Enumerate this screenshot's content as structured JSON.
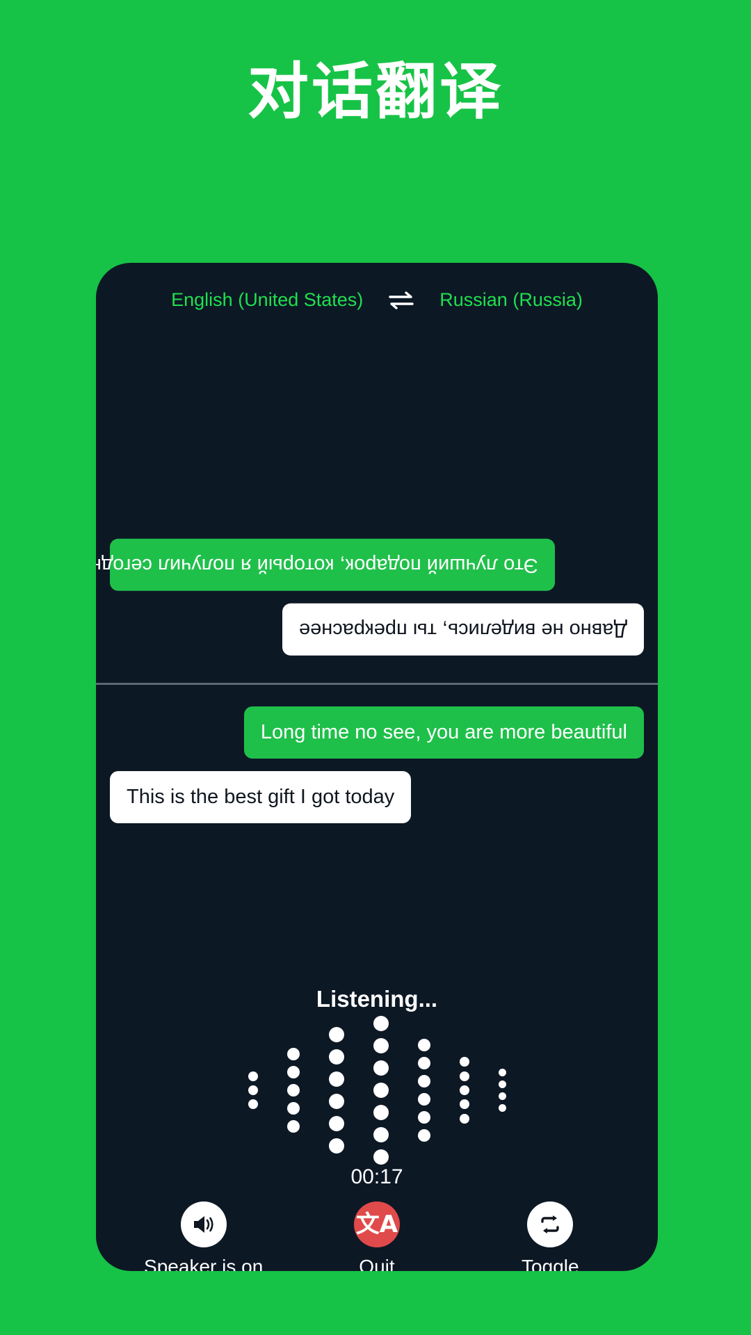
{
  "page": {
    "title": "对话翻译",
    "background_color": "#17c346"
  },
  "card": {
    "background_color": "#0d1825"
  },
  "languages": {
    "source": "English (United States)",
    "target": "Russian (Russia)",
    "swap_icon": "swap-horizontal-icon",
    "accent_color": "#1fe04e"
  },
  "conversation": {
    "top_pane": {
      "orientation": "rotated-180",
      "messages": [
        {
          "text": "Это лучший подарок, который я получил сегодня",
          "style": "green",
          "align": "left"
        },
        {
          "text": "Давно не виделись, ты прекраснее",
          "style": "white",
          "align": "right"
        }
      ]
    },
    "bottom_pane": {
      "orientation": "normal",
      "messages": [
        {
          "text": "Long time no see, you are more beautiful",
          "style": "green",
          "align": "right"
        },
        {
          "text": "This is the best gift I got today",
          "style": "white",
          "align": "left"
        }
      ]
    }
  },
  "status": {
    "listening_label": "Listening...",
    "timer": "00:17"
  },
  "waveform": {
    "columns": [
      {
        "dots": 3,
        "size": 14
      },
      {
        "dots": 5,
        "size": 18
      },
      {
        "dots": 6,
        "size": 22
      },
      {
        "dots": 7,
        "size": 22
      },
      {
        "dots": 6,
        "size": 18
      },
      {
        "dots": 5,
        "size": 14
      },
      {
        "dots": 4,
        "size": 11
      }
    ],
    "dot_color": "#ffffff"
  },
  "controls": [
    {
      "label": "Speaker is on",
      "icon": "speaker-on-icon",
      "style": "light"
    },
    {
      "label": "Quit",
      "icon": "translate-icon",
      "style": "danger",
      "color": "#e04a4a"
    },
    {
      "label": "Toggle",
      "icon": "swap-repeat-icon",
      "style": "light"
    }
  ]
}
